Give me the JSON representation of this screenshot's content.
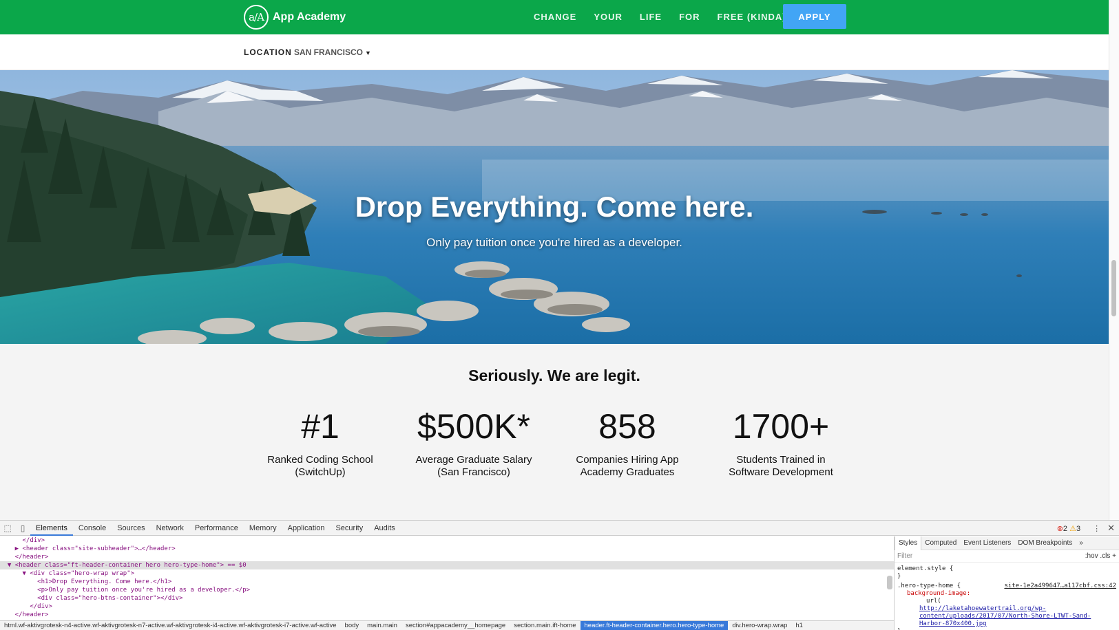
{
  "header": {
    "logo_mark": "a/A",
    "logo_text": "App Academy",
    "nav": [
      "CHANGE",
      "YOUR",
      "LIFE",
      "FOR",
      "FREE (KINDA)"
    ],
    "apply_label": "APPLY",
    "brand_color": "#0ba74a",
    "apply_color": "#42a5f5"
  },
  "subheader": {
    "location_label": "LOCATION",
    "location_value": "SAN FRANCISCO"
  },
  "hero": {
    "title": "Drop Everything. Come here.",
    "subtitle": "Only pay tuition once you're hired as a developer."
  },
  "stats": {
    "heading": "Seriously. We are legit.",
    "items": [
      {
        "value": "#1",
        "label": "Ranked Coding School\n(SwitchUp)"
      },
      {
        "value": "$500K*",
        "label": "Average Graduate Salary\n(San Francisco)"
      },
      {
        "value": "858",
        "label": "Companies Hiring App\nAcademy Graduates"
      },
      {
        "value": "1700+",
        "label": "Students Trained in\nSoftware Development"
      }
    ]
  },
  "devtools": {
    "tabs": [
      "Elements",
      "Console",
      "Sources",
      "Network",
      "Performance",
      "Memory",
      "Application",
      "Security",
      "Audits"
    ],
    "active_tab": "Elements",
    "error_count": "2",
    "warning_count": "3",
    "dom_lines": [
      "      </div>",
      "    ▶ <header class=\"site-subheader\">…</header>",
      "    </header>",
      "  ▼ <header class=\"ft-header-container hero hero-type-home\"> == $0",
      "      ▼ <div class=\"hero-wrap wrap\">",
      "          <h1>Drop Everything. Come here.</h1>",
      "          <p>Only pay tuition once you're hired as a developer.</p>",
      "          <div class=\"hero-btns-container\"></div>",
      "        </div>",
      "    </header>"
    ],
    "breadcrumbs": [
      "html.wf-aktivgrotesk-n4-active.wf-aktivgrotesk-n7-active.wf-aktivgrotesk-i4-active.wf-aktivgrotesk-i7-active.wf-active",
      "body",
      "main.main",
      "section#appacademy__homepage",
      "section.main.ift-home",
      "header.ft-header-container.hero.hero-type-home",
      "div.hero-wrap.wrap",
      "h1"
    ],
    "active_breadcrumb": "header.ft-header-container.hero.hero-type-home",
    "styles_tabs": [
      "Styles",
      "Computed",
      "Event Listeners",
      "DOM Breakpoints"
    ],
    "styles_more": "»",
    "filter_placeholder": "Filter",
    "filter_controls": ":hov  .cls  +",
    "element_style": "element.style {",
    "close_brace": "}",
    "rule_selector": ".hero-type-home {",
    "rule_source": "site-1e2a499647…a117cbf.css:42",
    "rule_property": "background-image:",
    "rule_url_fn": "url(",
    "rule_url": "http://laketahoewatertrail.org/wp-content/uploads/2017/07/North-Shore-LTWT-Sand-Harbor-870x400.jpg",
    "rule_url_end": ");"
  }
}
